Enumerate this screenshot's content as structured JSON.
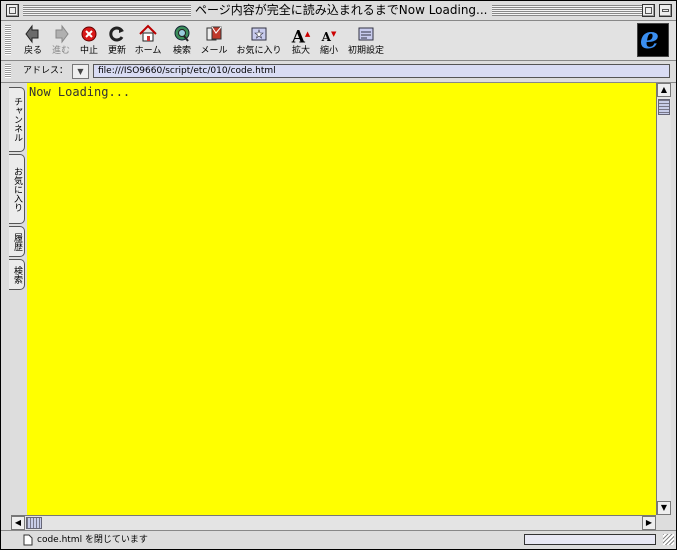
{
  "window": {
    "title": "ページ内容が完全に読み込まれるまでNow Loading..."
  },
  "toolbar": {
    "buttons": [
      {
        "label": "戻る",
        "icon": "back-arrow-icon",
        "enabled": true
      },
      {
        "label": "進む",
        "icon": "forward-arrow-icon",
        "enabled": false
      },
      {
        "label": "中止",
        "icon": "stop-icon",
        "enabled": true
      },
      {
        "label": "更新",
        "icon": "refresh-icon",
        "enabled": true
      },
      {
        "label": "ホーム",
        "icon": "home-icon",
        "enabled": true
      },
      {
        "label": "検索",
        "icon": "search-icon",
        "enabled": true
      },
      {
        "label": "メール",
        "icon": "mail-icon",
        "enabled": true
      },
      {
        "label": "お気に入り",
        "icon": "favorites-icon",
        "enabled": true
      },
      {
        "label": "拡大",
        "icon": "text-larger-icon",
        "enabled": true
      },
      {
        "label": "縮小",
        "icon": "text-smaller-icon",
        "enabled": true
      },
      {
        "label": "初期設定",
        "icon": "preferences-icon",
        "enabled": true
      }
    ],
    "logo_letter": "e"
  },
  "address": {
    "label": "アドレス：",
    "value": "file:///ISO9660/script/etc/010/code.html"
  },
  "sidebar": {
    "tabs": [
      "チャンネル",
      "お気に入り",
      "履歴",
      "検索"
    ]
  },
  "content": {
    "text": "Now Loading...",
    "background": "#ffff00"
  },
  "status": {
    "text": "code.html を閉じています"
  },
  "colors": {
    "address_field": "#d9dcf3",
    "scroll_thumb": "#c8cde8"
  }
}
